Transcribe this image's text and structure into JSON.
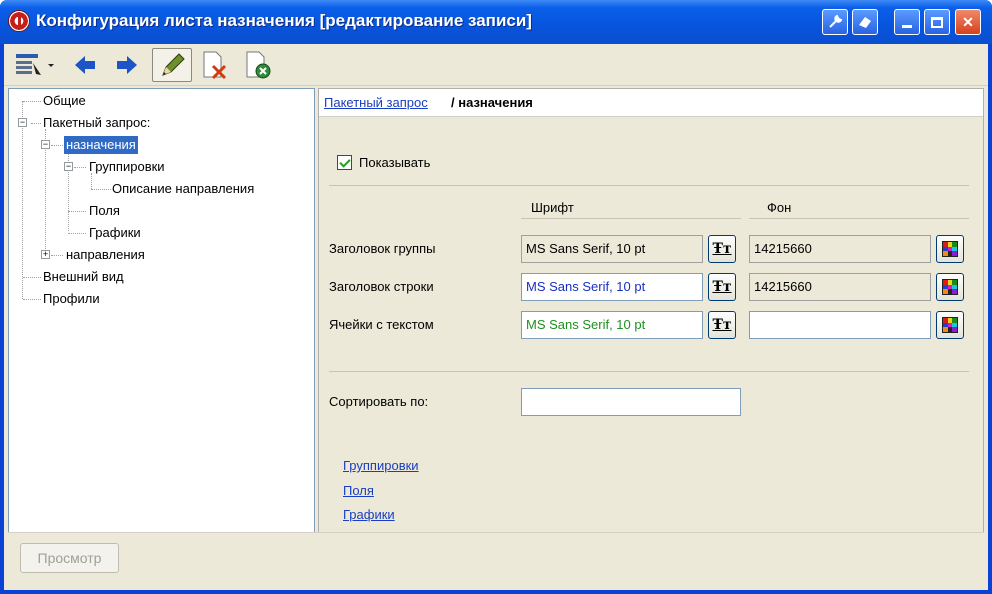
{
  "window": {
    "title": "Конфигурация листа назначения [редактирование записи]",
    "title_buttons": [
      "wrench-icon",
      "eraser-icon",
      "minimize-icon",
      "maximize-icon",
      "close-icon"
    ]
  },
  "toolbar": {
    "tools": [
      "list-menu-icon",
      "back-arrow-icon",
      "forward-arrow-icon",
      "pencil-icon",
      "delete-doc-icon",
      "close-doc-icon"
    ]
  },
  "tree": {
    "items": [
      {
        "label": "Общие"
      },
      {
        "label": "Пакетный запрос:"
      },
      {
        "label": "назначения",
        "selected": true
      },
      {
        "label": "Группировки"
      },
      {
        "label": "Описание направления"
      },
      {
        "label": "Поля"
      },
      {
        "label": "Графики"
      },
      {
        "label": "направления"
      },
      {
        "label": "Внешний вид"
      },
      {
        "label": "Профили"
      }
    ]
  },
  "panel": {
    "breadcrumb_link": "Пакетный запрос",
    "breadcrumb_current": "/ назначения",
    "show_label": "Показывать",
    "font_header": "Шрифт",
    "bg_header": "Фон",
    "rows": [
      {
        "label": "Заголовок группы",
        "font": "MS Sans Serif, 10 pt",
        "font_color": "#000000",
        "bg": "14215660"
      },
      {
        "label": "Заголовок строки",
        "font": "MS Sans Serif, 10 pt",
        "font_color": "#1a2fbf",
        "bg": "14215660"
      },
      {
        "label": "Ячейки с текстом",
        "font": "MS Sans Serif, 10 pt",
        "font_color": "#1f8f1f",
        "bg": ""
      }
    ],
    "sort_label": "Сортировать по:",
    "sort_value": "",
    "links": [
      "Группировки",
      "Поля",
      "Графики"
    ]
  },
  "footer": {
    "preview_label": "Просмотр"
  }
}
